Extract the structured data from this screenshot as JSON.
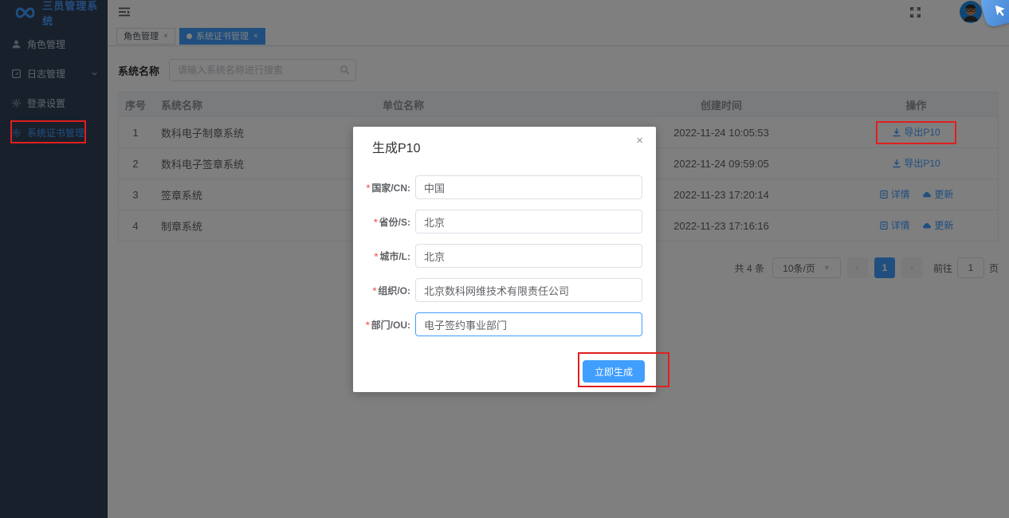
{
  "app": {
    "title": "三员管理系统"
  },
  "sidebar": {
    "items": [
      {
        "label": "角色管理",
        "icon": "user-icon"
      },
      {
        "label": "日志管理",
        "icon": "log-icon",
        "expandable": true
      },
      {
        "label": "登录设置",
        "icon": "gear-icon"
      },
      {
        "label": "系统证书管理",
        "icon": "gear-icon",
        "active": true
      }
    ]
  },
  "tabs": [
    {
      "label": "角色管理",
      "close": "×"
    },
    {
      "label": "系统证书管理",
      "close": "×",
      "active": true
    }
  ],
  "search": {
    "label": "系统名称",
    "placeholder": "请输入系统名称进行搜索",
    "value": ""
  },
  "table": {
    "columns": {
      "seq": "序号",
      "name": "系统名称",
      "org": "单位名称",
      "created": "创建时间",
      "op": "操作"
    },
    "rows": [
      {
        "seq": "1",
        "name": "数科电子制章系统",
        "org": "",
        "created": "2022-11-24 10:05:53",
        "actions": [
          {
            "label": "导出P10",
            "icon": "download-icon"
          }
        ]
      },
      {
        "seq": "2",
        "name": "数科电子签章系统",
        "org": "",
        "created": "2022-11-24 09:59:05",
        "actions": [
          {
            "label": "导出P10",
            "icon": "download-icon"
          }
        ]
      },
      {
        "seq": "3",
        "name": "签章系统",
        "org": "",
        "created": "2022-11-23 17:20:14",
        "actions": [
          {
            "label": "详情",
            "icon": "document-icon"
          },
          {
            "label": "更新",
            "icon": "cloud-icon"
          }
        ]
      },
      {
        "seq": "4",
        "name": "制章系统",
        "org": "",
        "created": "2022-11-23 17:16:16",
        "actions": [
          {
            "label": "详情",
            "icon": "document-icon"
          },
          {
            "label": "更新",
            "icon": "cloud-icon"
          }
        ]
      }
    ]
  },
  "pagination": {
    "total": "共 4 条",
    "page_size": "10条/页",
    "prev": "‹",
    "current_page": "1",
    "next": "›",
    "goto_label": "前往",
    "goto_value": "1",
    "goto_suffix": "页"
  },
  "modal": {
    "title": "生成P10",
    "close": "×",
    "fields": [
      {
        "label": "国家/CN:",
        "value": "中国"
      },
      {
        "label": "省份/S:",
        "value": "北京"
      },
      {
        "label": "城市/L:",
        "value": "北京"
      },
      {
        "label": "组织/O:",
        "value": "北京数科网维技术有限责任公司"
      },
      {
        "label": "部门/OU:",
        "value": "电子签约事业部门",
        "focused": true
      }
    ],
    "submit_label": "立即生成"
  },
  "colors": {
    "accent": "#409EFF",
    "sidebar_bg": "#304156",
    "annotation_red": "#e01f1f",
    "required_red": "#f56c6c"
  }
}
